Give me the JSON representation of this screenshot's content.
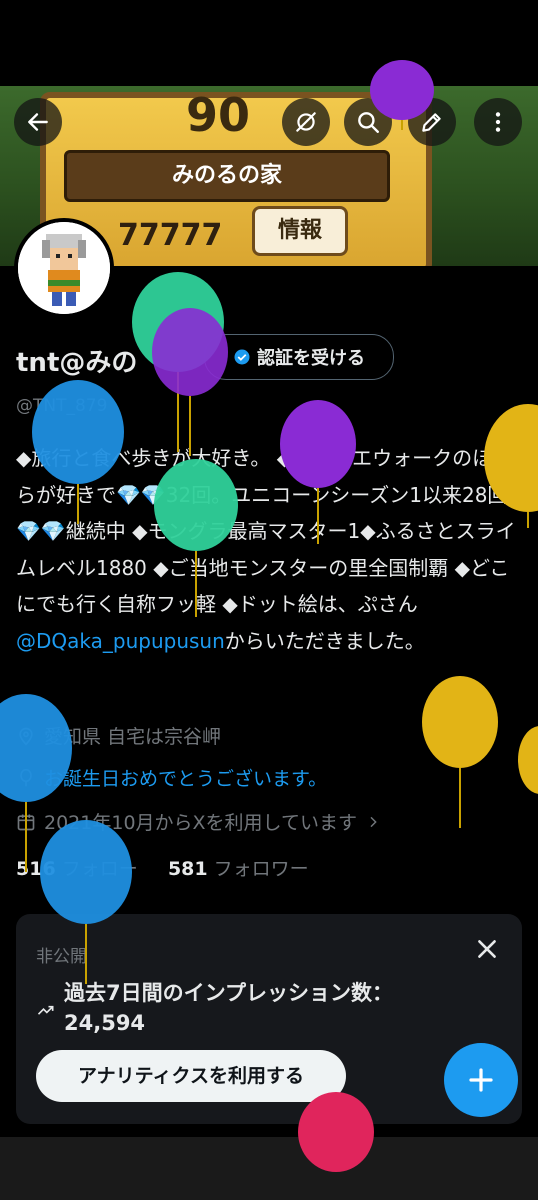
{
  "banner": {
    "level": "90",
    "house_name": "みのるの家",
    "gold": "77777",
    "info_button": "情報"
  },
  "header_icons": [
    "back-arrow-icon",
    "grok-icon",
    "search-icon",
    "compose-icon",
    "more-icon"
  ],
  "profile": {
    "name": "tnt@みの",
    "verify_label": "認証を受ける",
    "handle": "@TNT_879",
    "bio_text": "◆旅行と食べ歩きが大好き。 ◆ドラクエウォークのほこらが好きで💎💎32回。ユニコーンシーズン1以来28回💎💎継続中 ◆モングラ最高マスター1◆ふるさとスライムレベル1880 ◆ご当地モンスターの里全国制覇 ◆どこにでも行く自称フッ軽 ◆ドット絵は、ぷさん",
    "bio_link": "@DQaka_pupupusun",
    "bio_tail": "からいただきました。",
    "location": "愛知県 自宅は宗谷岬",
    "birthday": "お誕生日おめでとうございます。",
    "joined": "2021年10月からXを利用しています",
    "following_count": "516",
    "following_label": "フォロー",
    "followers_count": "581",
    "followers_label": "フォロワー"
  },
  "analytics": {
    "private_label": "非公開",
    "impressions_label": "過去7日間のインプレッション数：",
    "impressions_value": "24,594",
    "button_label": "アナリティクスを利用する"
  },
  "colors": {
    "background": "#000000",
    "accent": "#1d9bf0",
    "text": "#e7e9ea",
    "muted": "#71767b",
    "card": "#16181c"
  }
}
